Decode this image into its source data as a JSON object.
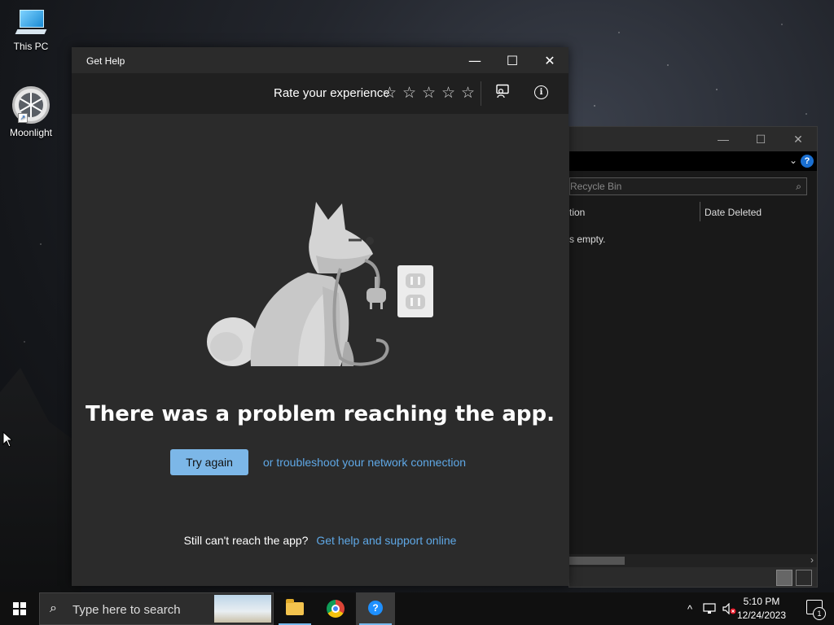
{
  "desktop": {
    "icons": [
      {
        "label": "This PC"
      },
      {
        "label": "Moonlight"
      }
    ]
  },
  "explorer": {
    "search_placeholder": "Recycle Bin",
    "columns": [
      "tion",
      "Date Deleted"
    ],
    "empty_text": "s empty.",
    "help_glyph": "?"
  },
  "gethelp": {
    "title": "Get Help",
    "rate_label": "Rate your experience",
    "stars": [
      "☆",
      "☆",
      "☆",
      "☆",
      "☆"
    ],
    "headline": "There was a problem reaching the app.",
    "try_again": "Try again",
    "troubleshoot_link": "or troubleshoot your network connection",
    "still_text": "Still can't reach the app?",
    "support_link": "Get help and support online"
  },
  "taskbar": {
    "search_placeholder": "Type here to search",
    "time": "5:10 PM",
    "date": "12/24/2023",
    "notification_count": "1"
  },
  "colors": {
    "accent_button": "#7cb7e8",
    "link": "#5fa8e6",
    "window_bg": "#2b2b2b"
  }
}
